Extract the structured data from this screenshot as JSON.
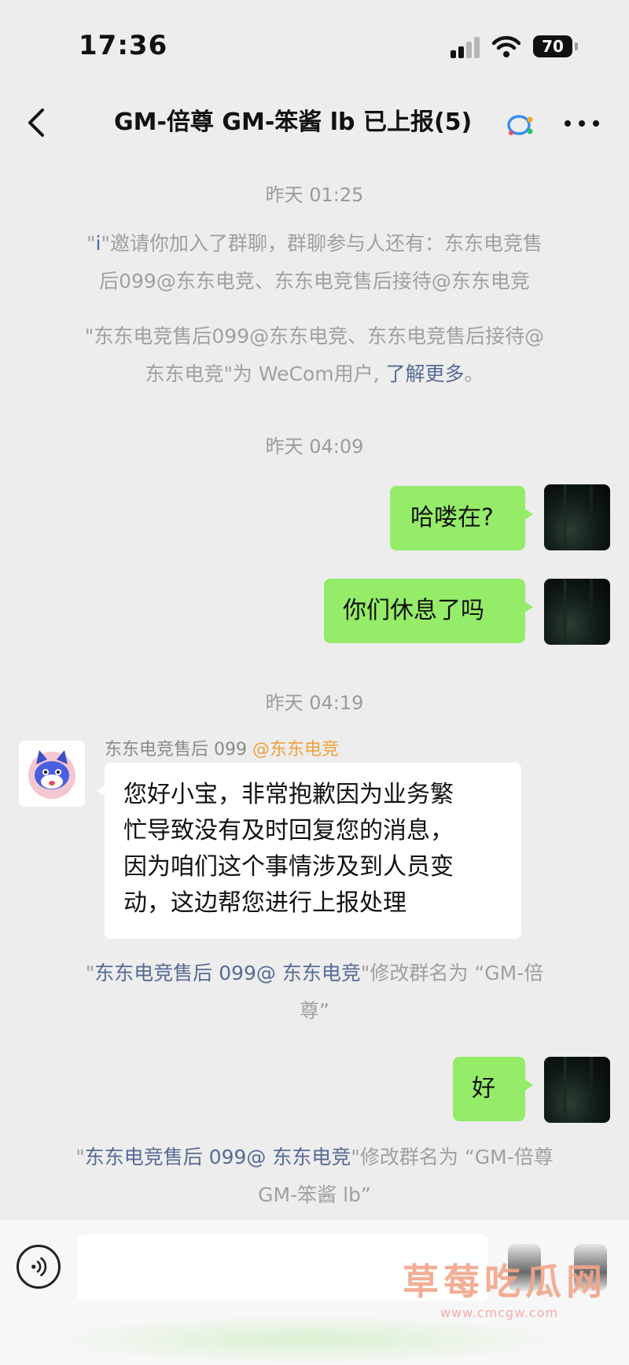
{
  "status_bar": {
    "time": "17:36",
    "battery": "70"
  },
  "nav": {
    "title": "GM-倍尊 GM-笨酱 lb 已上报(5)"
  },
  "messages": {
    "ts1": "昨天 01:25",
    "sys1_prefix": "\"",
    "sys1_i": "i",
    "sys1_line1": "\"邀请你加入了群聊，群聊参与人还有：东东电竞售",
    "sys1_line2": "后099@东东电竞、东东电竞售后接待@东东电竞",
    "sys2_line1": "\"东东电竞售后099@东东电竞、东东电竞售后接待@",
    "sys2_line2_pre": "东东电竞\"为 WeCom用户, ",
    "sys2_link": "了解更多",
    "sys2_end": "。",
    "ts2": "昨天 04:09",
    "out1": "哈喽在?",
    "out2": "你们休息了吗",
    "ts3": "昨天 04:19",
    "sender": "东东电竞售后 099",
    "sender_corp": "@东东电竞",
    "in1_line1": "您好小宝，非常抱歉因为业务繁",
    "in1_line2": "忙导致没有及时回复您的消息，",
    "in1_line3": "因为咱们这个事情涉及到人员变",
    "in1_line4": "动，这边帮您进行上报处理",
    "sys3_q1": "\"",
    "sys3_name": "东东电竞售后 099@ 东东电竞",
    "sys3_rest": "\"修改群名为 “GM-倍",
    "sys3_line2": "尊”",
    "out3": "好",
    "sys4_q1": "\"",
    "sys4_name": "东东电竞售后 099@ 东东电竞",
    "sys4_rest": "\"修改群名为 “GM-倍尊",
    "sys4_line2": "GM-笨酱 lb”"
  },
  "watermark": {
    "text": "草莓吃瓜网",
    "url": "www.cmcgw.com"
  },
  "colors": {
    "bubble_out": "#95ec69",
    "bubble_in": "#ffffff",
    "background": "#ededed",
    "link": "#576b95",
    "corp_tag": "#f0a03a"
  },
  "icons": [
    "back-chevron-icon",
    "wecom-icon",
    "more-icon",
    "voice-icon",
    "emoji-icon",
    "plus-icon"
  ]
}
